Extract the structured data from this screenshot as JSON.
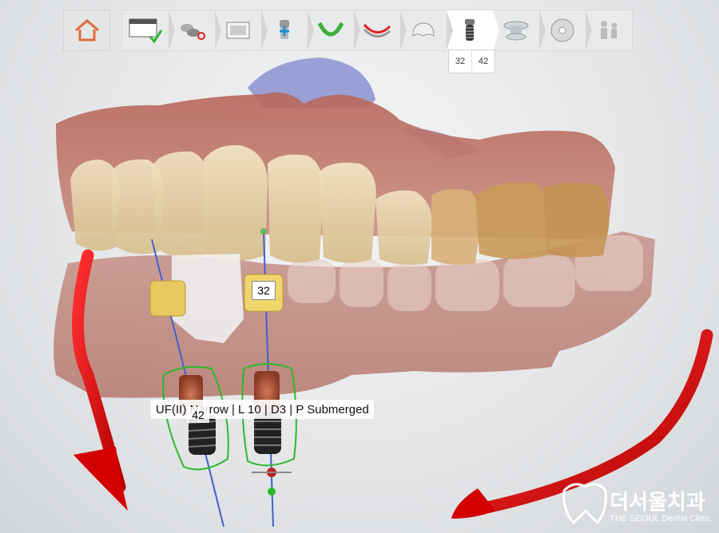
{
  "toolbar": {
    "home_icon": "home-icon",
    "steps": [
      {
        "icon": "order-form-icon",
        "status": "completed"
      },
      {
        "icon": "scan-tools-icon"
      },
      {
        "icon": "scan-preview-icon"
      },
      {
        "icon": "add-implant-icon"
      },
      {
        "icon": "lower-jaw-icon"
      },
      {
        "icon": "bite-alignment-icon"
      },
      {
        "icon": "crown-icon"
      },
      {
        "icon": "implant-icon",
        "active": true
      },
      {
        "icon": "sleeve-icon"
      },
      {
        "icon": "export-disc-icon"
      },
      {
        "icon": "people-icon"
      }
    ]
  },
  "implant_tabs": [
    "32",
    "42"
  ],
  "implant_info": "UF(II) Narrow | L 10 | D3 | P Submerged",
  "tooth_labels": {
    "t32": "32",
    "t42": "42"
  },
  "logo": {
    "korean": "더서울치과",
    "english": "THE SEOUL Dental Clinic"
  },
  "colors": {
    "rotation_arrow": "#d40000",
    "guide_green": "#2db82d",
    "axis_blue": "#4060d0"
  }
}
